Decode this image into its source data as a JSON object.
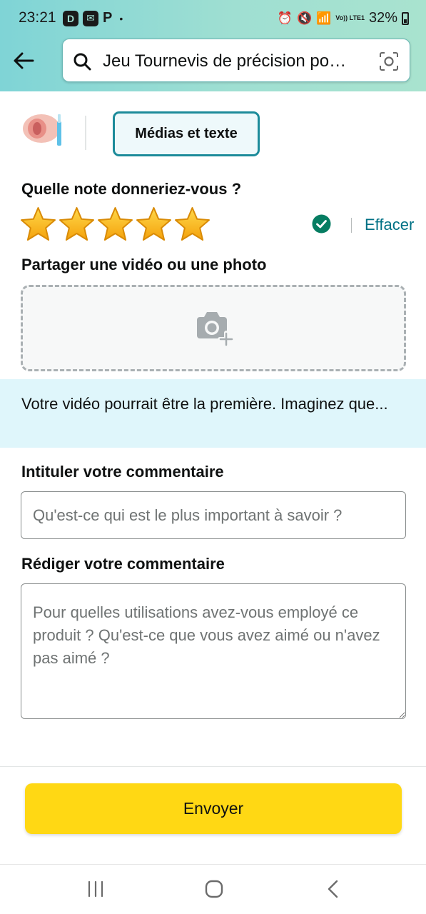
{
  "status_bar": {
    "time": "23:21",
    "left_icons": [
      "app-notification-icon",
      "mail-notification-icon",
      "p-notification-icon"
    ],
    "left_badges": [
      "D",
      "✉",
      "P"
    ],
    "dot": "•",
    "lte_label": "Vo)) LTE1",
    "battery_percent": "32%"
  },
  "header": {
    "search_text": "Jeu Tournevis de précision po…",
    "colors": {
      "gradient_start": "#7fd4d6",
      "gradient_end": "#a9e3cf"
    }
  },
  "tabs": {
    "media_text_label": "Médias et texte"
  },
  "rating": {
    "question": "Quelle note donneriez-vous ?",
    "stars_filled": 5,
    "stars_total": 5,
    "clear_label": "Effacer"
  },
  "media": {
    "title": "Partager une vidéo ou une photo"
  },
  "banner": {
    "text": "Votre vidéo pourrait être la première. Imaginez que..."
  },
  "review_title": {
    "label": "Intituler votre commentaire",
    "placeholder": "Qu'est-ce qui est le plus important à savoir ?",
    "value": ""
  },
  "review_body": {
    "label": "Rédiger votre commentaire",
    "placeholder": "Pour quelles utilisations avez-vous employé ce produit ? Qu'est-ce que vous avez aimé ou n'avez pas aimé ?",
    "value": ""
  },
  "footer": {
    "submit_label": "Envoyer",
    "submit_color": "#ffd814"
  },
  "accent_color": "#007185"
}
